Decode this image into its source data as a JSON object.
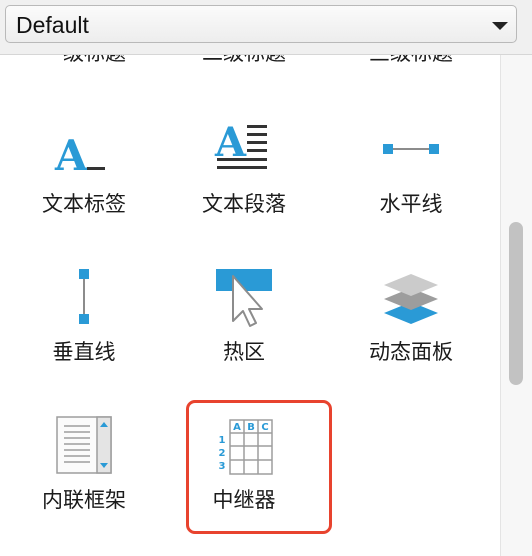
{
  "dropdown": {
    "value": "Default"
  },
  "library": {
    "top_row_partial_labels": [
      "一级标题",
      "二级标题",
      "三级标题"
    ],
    "items": [
      {
        "label": "文本标签",
        "icon": "text-label-icon"
      },
      {
        "label": "文本段落",
        "icon": "text-paragraph-icon"
      },
      {
        "label": "水平线",
        "icon": "horizontal-line-icon"
      },
      {
        "label": "垂直线",
        "icon": "vertical-line-icon"
      },
      {
        "label": "热区",
        "icon": "hotspot-icon"
      },
      {
        "label": "动态面板",
        "icon": "dynamic-panel-icon"
      },
      {
        "label": "内联框架",
        "icon": "inline-frame-icon"
      },
      {
        "label": "中继器",
        "icon": "repeater-icon"
      }
    ],
    "selected": "中继器",
    "repeater_icon_text": {
      "headers": [
        "A",
        "B",
        "C"
      ],
      "rows": [
        "1",
        "2",
        "3"
      ]
    },
    "icon_text_glyph": "A"
  },
  "colors": {
    "accent": "#2a9ad6",
    "highlight": "#e8432e",
    "icon_gray": "#8c8c8c"
  }
}
